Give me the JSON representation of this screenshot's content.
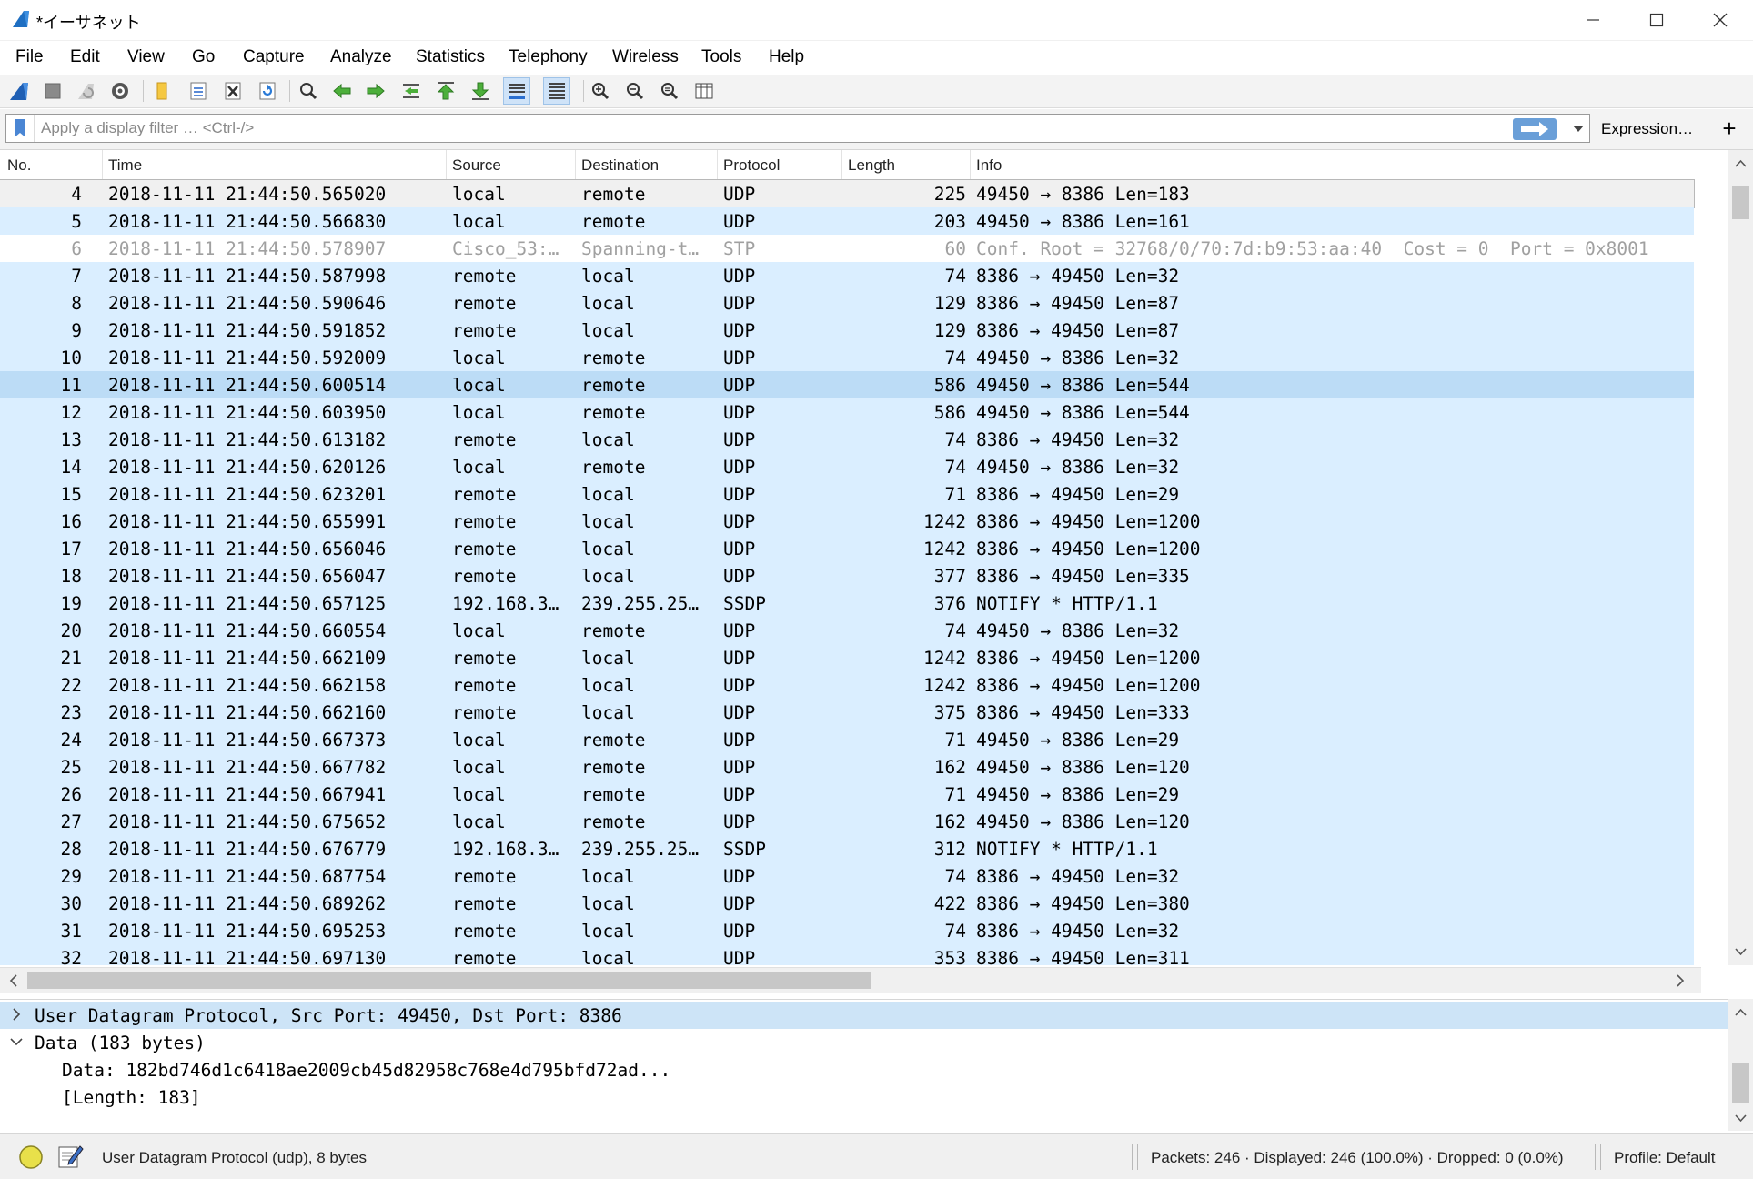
{
  "window": {
    "title": "*イーサネット",
    "minimize_icon": "minimize-icon",
    "maximize_icon": "maximize-icon",
    "close_icon": "close-icon"
  },
  "menu": [
    "File",
    "Edit",
    "View",
    "Go",
    "Capture",
    "Analyze",
    "Statistics",
    "Telephony",
    "Wireless",
    "Tools",
    "Help"
  ],
  "toolbar": {
    "icons": [
      "shark-fin-start-icon",
      "stop-icon",
      "restart-icon",
      "options-gear-icon",
      "open-folder-icon",
      "save-file-icon",
      "close-file-icon",
      "reload-icon",
      "find-icon",
      "go-back-icon",
      "go-forward-icon",
      "go-to-packet-icon",
      "first-packet-icon",
      "last-packet-icon",
      "autoscroll-icon",
      "colorize-icon",
      "zoom-in-icon",
      "zoom-out-icon",
      "normal-size-icon",
      "resize-columns-icon"
    ]
  },
  "filter": {
    "placeholder": "Apply a display filter … <Ctrl-/>",
    "value": "",
    "expression_label": "Expression…",
    "add_label": "+"
  },
  "columns": [
    "No.",
    "Time",
    "Source",
    "Destination",
    "Protocol",
    "Length",
    "Info"
  ],
  "packets": [
    {
      "no": "4",
      "time": "2018-11-11 21:44:50.565020",
      "src": "local",
      "dst": "remote",
      "proto": "UDP",
      "len": "225",
      "info": "49450 → 8386 Len=183",
      "style": "selected"
    },
    {
      "no": "5",
      "time": "2018-11-11 21:44:50.566830",
      "src": "local",
      "dst": "remote",
      "proto": "UDP",
      "len": "203",
      "info": "49450 → 8386 Len=161",
      "style": "udp"
    },
    {
      "no": "6",
      "time": "2018-11-11 21:44:50.578907",
      "src": "Cisco_53:…",
      "dst": "Spanning-t…",
      "proto": "STP",
      "len": "60",
      "info": "Conf. Root = 32768/0/70:7d:b9:53:aa:40  Cost = 0  Port = 0x8001",
      "style": "stp"
    },
    {
      "no": "7",
      "time": "2018-11-11 21:44:50.587998",
      "src": "remote",
      "dst": "local",
      "proto": "UDP",
      "len": "74",
      "info": "8386 → 49450 Len=32",
      "style": "udp"
    },
    {
      "no": "8",
      "time": "2018-11-11 21:44:50.590646",
      "src": "remote",
      "dst": "local",
      "proto": "UDP",
      "len": "129",
      "info": "8386 → 49450 Len=87",
      "style": "udp"
    },
    {
      "no": "9",
      "time": "2018-11-11 21:44:50.591852",
      "src": "remote",
      "dst": "local",
      "proto": "UDP",
      "len": "129",
      "info": "8386 → 49450 Len=87",
      "style": "udp"
    },
    {
      "no": "10",
      "time": "2018-11-11 21:44:50.592009",
      "src": "local",
      "dst": "remote",
      "proto": "UDP",
      "len": "74",
      "info": "49450 → 8386 Len=32",
      "style": "udp"
    },
    {
      "no": "11",
      "time": "2018-11-11 21:44:50.600514",
      "src": "local",
      "dst": "remote",
      "proto": "UDP",
      "len": "586",
      "info": "49450 → 8386 Len=544",
      "style": "hover"
    },
    {
      "no": "12",
      "time": "2018-11-11 21:44:50.603950",
      "src": "local",
      "dst": "remote",
      "proto": "UDP",
      "len": "586",
      "info": "49450 → 8386 Len=544",
      "style": "udp"
    },
    {
      "no": "13",
      "time": "2018-11-11 21:44:50.613182",
      "src": "remote",
      "dst": "local",
      "proto": "UDP",
      "len": "74",
      "info": "8386 → 49450 Len=32",
      "style": "udp"
    },
    {
      "no": "14",
      "time": "2018-11-11 21:44:50.620126",
      "src": "local",
      "dst": "remote",
      "proto": "UDP",
      "len": "74",
      "info": "49450 → 8386 Len=32",
      "style": "udp"
    },
    {
      "no": "15",
      "time": "2018-11-11 21:44:50.623201",
      "src": "remote",
      "dst": "local",
      "proto": "UDP",
      "len": "71",
      "info": "8386 → 49450 Len=29",
      "style": "udp"
    },
    {
      "no": "16",
      "time": "2018-11-11 21:44:50.655991",
      "src": "remote",
      "dst": "local",
      "proto": "UDP",
      "len": "1242",
      "info": "8386 → 49450 Len=1200",
      "style": "udp"
    },
    {
      "no": "17",
      "time": "2018-11-11 21:44:50.656046",
      "src": "remote",
      "dst": "local",
      "proto": "UDP",
      "len": "1242",
      "info": "8386 → 49450 Len=1200",
      "style": "udp"
    },
    {
      "no": "18",
      "time": "2018-11-11 21:44:50.656047",
      "src": "remote",
      "dst": "local",
      "proto": "UDP",
      "len": "377",
      "info": "8386 → 49450 Len=335",
      "style": "udp"
    },
    {
      "no": "19",
      "time": "2018-11-11 21:44:50.657125",
      "src": "192.168.3…",
      "dst": "239.255.25…",
      "proto": "SSDP",
      "len": "376",
      "info": "NOTIFY * HTTP/1.1",
      "style": "udp"
    },
    {
      "no": "20",
      "time": "2018-11-11 21:44:50.660554",
      "src": "local",
      "dst": "remote",
      "proto": "UDP",
      "len": "74",
      "info": "49450 → 8386 Len=32",
      "style": "udp"
    },
    {
      "no": "21",
      "time": "2018-11-11 21:44:50.662109",
      "src": "remote",
      "dst": "local",
      "proto": "UDP",
      "len": "1242",
      "info": "8386 → 49450 Len=1200",
      "style": "udp"
    },
    {
      "no": "22",
      "time": "2018-11-11 21:44:50.662158",
      "src": "remote",
      "dst": "local",
      "proto": "UDP",
      "len": "1242",
      "info": "8386 → 49450 Len=1200",
      "style": "udp"
    },
    {
      "no": "23",
      "time": "2018-11-11 21:44:50.662160",
      "src": "remote",
      "dst": "local",
      "proto": "UDP",
      "len": "375",
      "info": "8386 → 49450 Len=333",
      "style": "udp"
    },
    {
      "no": "24",
      "time": "2018-11-11 21:44:50.667373",
      "src": "local",
      "dst": "remote",
      "proto": "UDP",
      "len": "71",
      "info": "49450 → 8386 Len=29",
      "style": "udp"
    },
    {
      "no": "25",
      "time": "2018-11-11 21:44:50.667782",
      "src": "local",
      "dst": "remote",
      "proto": "UDP",
      "len": "162",
      "info": "49450 → 8386 Len=120",
      "style": "udp"
    },
    {
      "no": "26",
      "time": "2018-11-11 21:44:50.667941",
      "src": "local",
      "dst": "remote",
      "proto": "UDP",
      "len": "71",
      "info": "49450 → 8386 Len=29",
      "style": "udp"
    },
    {
      "no": "27",
      "time": "2018-11-11 21:44:50.675652",
      "src": "local",
      "dst": "remote",
      "proto": "UDP",
      "len": "162",
      "info": "49450 → 8386 Len=120",
      "style": "udp"
    },
    {
      "no": "28",
      "time": "2018-11-11 21:44:50.676779",
      "src": "192.168.3…",
      "dst": "239.255.25…",
      "proto": "SSDP",
      "len": "312",
      "info": "NOTIFY * HTTP/1.1",
      "style": "udp"
    },
    {
      "no": "29",
      "time": "2018-11-11 21:44:50.687754",
      "src": "remote",
      "dst": "local",
      "proto": "UDP",
      "len": "74",
      "info": "8386 → 49450 Len=32",
      "style": "udp"
    },
    {
      "no": "30",
      "time": "2018-11-11 21:44:50.689262",
      "src": "remote",
      "dst": "local",
      "proto": "UDP",
      "len": "422",
      "info": "8386 → 49450 Len=380",
      "style": "udp"
    },
    {
      "no": "31",
      "time": "2018-11-11 21:44:50.695253",
      "src": "remote",
      "dst": "local",
      "proto": "UDP",
      "len": "74",
      "info": "8386 → 49450 Len=32",
      "style": "udp"
    },
    {
      "no": "32",
      "time": "2018-11-11 21:44:50.697130",
      "src": "remote",
      "dst": "local",
      "proto": "UDP",
      "len": "353",
      "info": "8386 → 49450 Len=311",
      "style": "udp"
    }
  ],
  "row_colors": {
    "udp": "#daeeff",
    "selected": "#f0f0f0",
    "stp": "#ffffff",
    "hover": "#bcdcf6",
    "stp_text": "#a0a0a0"
  },
  "details": [
    {
      "text": "User Datagram Protocol, Src Port: 49450, Dst Port: 8386",
      "expander": "collapsed",
      "highlight": true
    },
    {
      "text": "Data (183 bytes)",
      "expander": "expanded",
      "highlight": false
    },
    {
      "text": "Data: 182bd746d1c6418ae2009cb45d82958c768e4d795bfd72ad...",
      "expander": "none",
      "highlight": false
    },
    {
      "text": "[Length: 183]",
      "expander": "none",
      "highlight": false
    }
  ],
  "status": {
    "ready_icon": "capture-status-icon",
    "comment_icon": "edit-comment-icon",
    "field_info": "User Datagram Protocol (udp), 8 bytes",
    "packets": "Packets: 246 · Displayed: 246 (100.0%) · Dropped: 0 (0.0%)",
    "profile": "Profile: Default"
  }
}
